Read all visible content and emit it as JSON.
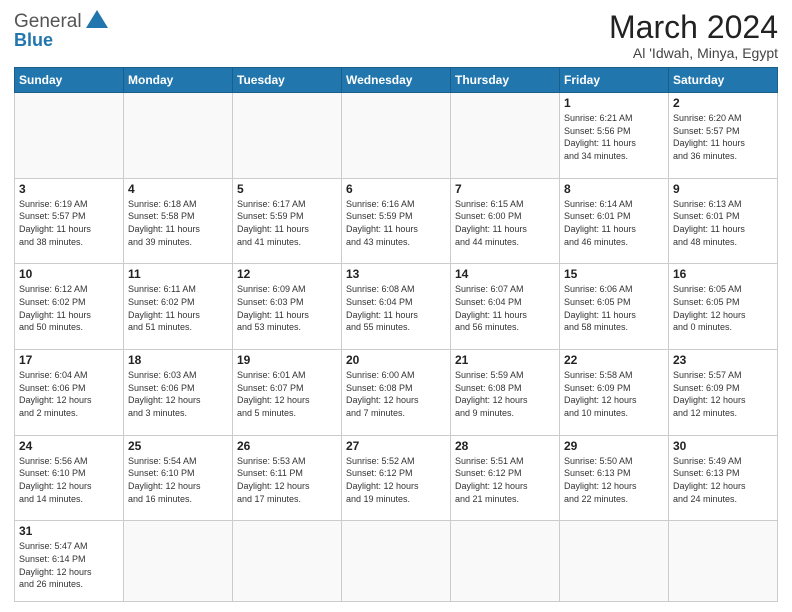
{
  "header": {
    "logo_general": "General",
    "logo_blue": "Blue",
    "month_title": "March 2024",
    "subtitle": "Al 'Idwah, Minya, Egypt"
  },
  "days_of_week": [
    "Sunday",
    "Monday",
    "Tuesday",
    "Wednesday",
    "Thursday",
    "Friday",
    "Saturday"
  ],
  "weeks": [
    [
      {
        "day": "",
        "info": ""
      },
      {
        "day": "",
        "info": ""
      },
      {
        "day": "",
        "info": ""
      },
      {
        "day": "",
        "info": ""
      },
      {
        "day": "",
        "info": ""
      },
      {
        "day": "1",
        "info": "Sunrise: 6:21 AM\nSunset: 5:56 PM\nDaylight: 11 hours\nand 34 minutes."
      },
      {
        "day": "2",
        "info": "Sunrise: 6:20 AM\nSunset: 5:57 PM\nDaylight: 11 hours\nand 36 minutes."
      }
    ],
    [
      {
        "day": "3",
        "info": "Sunrise: 6:19 AM\nSunset: 5:57 PM\nDaylight: 11 hours\nand 38 minutes."
      },
      {
        "day": "4",
        "info": "Sunrise: 6:18 AM\nSunset: 5:58 PM\nDaylight: 11 hours\nand 39 minutes."
      },
      {
        "day": "5",
        "info": "Sunrise: 6:17 AM\nSunset: 5:59 PM\nDaylight: 11 hours\nand 41 minutes."
      },
      {
        "day": "6",
        "info": "Sunrise: 6:16 AM\nSunset: 5:59 PM\nDaylight: 11 hours\nand 43 minutes."
      },
      {
        "day": "7",
        "info": "Sunrise: 6:15 AM\nSunset: 6:00 PM\nDaylight: 11 hours\nand 44 minutes."
      },
      {
        "day": "8",
        "info": "Sunrise: 6:14 AM\nSunset: 6:01 PM\nDaylight: 11 hours\nand 46 minutes."
      },
      {
        "day": "9",
        "info": "Sunrise: 6:13 AM\nSunset: 6:01 PM\nDaylight: 11 hours\nand 48 minutes."
      }
    ],
    [
      {
        "day": "10",
        "info": "Sunrise: 6:12 AM\nSunset: 6:02 PM\nDaylight: 11 hours\nand 50 minutes."
      },
      {
        "day": "11",
        "info": "Sunrise: 6:11 AM\nSunset: 6:02 PM\nDaylight: 11 hours\nand 51 minutes."
      },
      {
        "day": "12",
        "info": "Sunrise: 6:09 AM\nSunset: 6:03 PM\nDaylight: 11 hours\nand 53 minutes."
      },
      {
        "day": "13",
        "info": "Sunrise: 6:08 AM\nSunset: 6:04 PM\nDaylight: 11 hours\nand 55 minutes."
      },
      {
        "day": "14",
        "info": "Sunrise: 6:07 AM\nSunset: 6:04 PM\nDaylight: 11 hours\nand 56 minutes."
      },
      {
        "day": "15",
        "info": "Sunrise: 6:06 AM\nSunset: 6:05 PM\nDaylight: 11 hours\nand 58 minutes."
      },
      {
        "day": "16",
        "info": "Sunrise: 6:05 AM\nSunset: 6:05 PM\nDaylight: 12 hours\nand 0 minutes."
      }
    ],
    [
      {
        "day": "17",
        "info": "Sunrise: 6:04 AM\nSunset: 6:06 PM\nDaylight: 12 hours\nand 2 minutes."
      },
      {
        "day": "18",
        "info": "Sunrise: 6:03 AM\nSunset: 6:06 PM\nDaylight: 12 hours\nand 3 minutes."
      },
      {
        "day": "19",
        "info": "Sunrise: 6:01 AM\nSunset: 6:07 PM\nDaylight: 12 hours\nand 5 minutes."
      },
      {
        "day": "20",
        "info": "Sunrise: 6:00 AM\nSunset: 6:08 PM\nDaylight: 12 hours\nand 7 minutes."
      },
      {
        "day": "21",
        "info": "Sunrise: 5:59 AM\nSunset: 6:08 PM\nDaylight: 12 hours\nand 9 minutes."
      },
      {
        "day": "22",
        "info": "Sunrise: 5:58 AM\nSunset: 6:09 PM\nDaylight: 12 hours\nand 10 minutes."
      },
      {
        "day": "23",
        "info": "Sunrise: 5:57 AM\nSunset: 6:09 PM\nDaylight: 12 hours\nand 12 minutes."
      }
    ],
    [
      {
        "day": "24",
        "info": "Sunrise: 5:56 AM\nSunset: 6:10 PM\nDaylight: 12 hours\nand 14 minutes."
      },
      {
        "day": "25",
        "info": "Sunrise: 5:54 AM\nSunset: 6:10 PM\nDaylight: 12 hours\nand 16 minutes."
      },
      {
        "day": "26",
        "info": "Sunrise: 5:53 AM\nSunset: 6:11 PM\nDaylight: 12 hours\nand 17 minutes."
      },
      {
        "day": "27",
        "info": "Sunrise: 5:52 AM\nSunset: 6:12 PM\nDaylight: 12 hours\nand 19 minutes."
      },
      {
        "day": "28",
        "info": "Sunrise: 5:51 AM\nSunset: 6:12 PM\nDaylight: 12 hours\nand 21 minutes."
      },
      {
        "day": "29",
        "info": "Sunrise: 5:50 AM\nSunset: 6:13 PM\nDaylight: 12 hours\nand 22 minutes."
      },
      {
        "day": "30",
        "info": "Sunrise: 5:49 AM\nSunset: 6:13 PM\nDaylight: 12 hours\nand 24 minutes."
      }
    ],
    [
      {
        "day": "31",
        "info": "Sunrise: 5:47 AM\nSunset: 6:14 PM\nDaylight: 12 hours\nand 26 minutes."
      },
      {
        "day": "",
        "info": ""
      },
      {
        "day": "",
        "info": ""
      },
      {
        "day": "",
        "info": ""
      },
      {
        "day": "",
        "info": ""
      },
      {
        "day": "",
        "info": ""
      },
      {
        "day": "",
        "info": ""
      }
    ]
  ]
}
